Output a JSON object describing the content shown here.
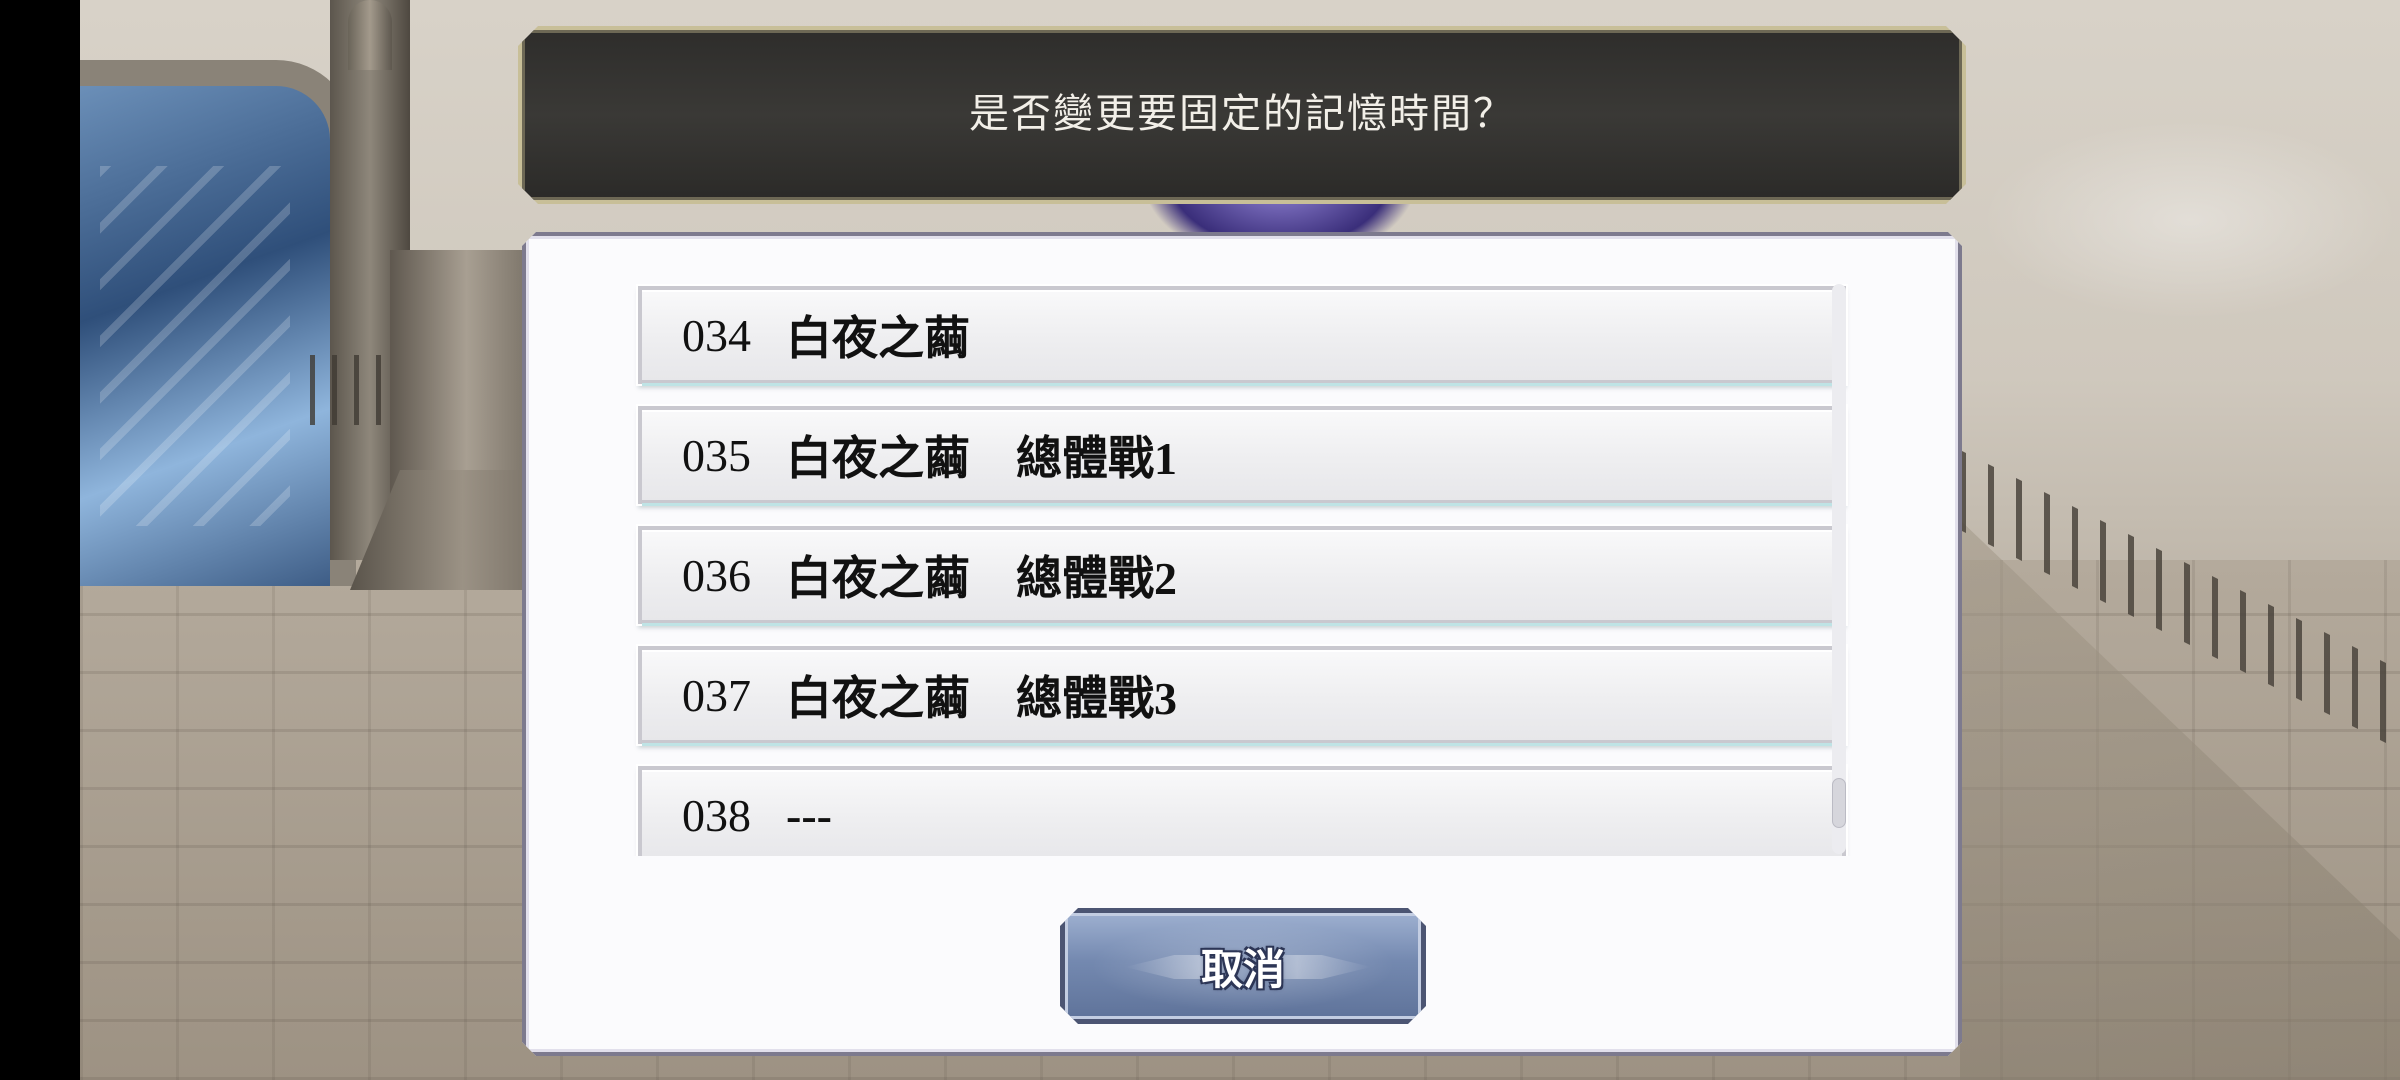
{
  "dialog": {
    "title": "是否變更要固定的記憶時間？",
    "cancel_label": "取消"
  },
  "list": {
    "items": [
      {
        "number": "034",
        "title": "白夜之繭"
      },
      {
        "number": "035",
        "title": "白夜之繭　總體戰1"
      },
      {
        "number": "036",
        "title": "白夜之繭　總體戰2"
      },
      {
        "number": "037",
        "title": "白夜之繭　總體戰3"
      },
      {
        "number": "038",
        "title": "---"
      }
    ],
    "scroll_position": 0.95
  },
  "colors": {
    "title_banner_bg": "#333230",
    "title_border": "#c8bf98",
    "panel_bg": "#fbfbfd",
    "button_fill": "#7489b0"
  }
}
